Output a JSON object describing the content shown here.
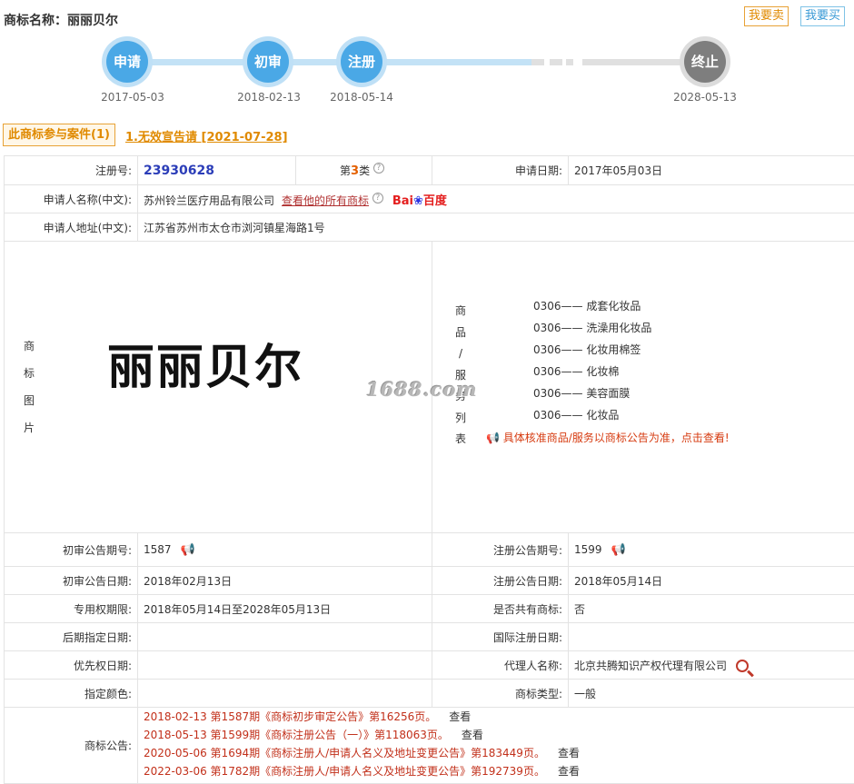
{
  "header": {
    "title": "商标名称：丽丽贝尔",
    "sell_label": "我要卖",
    "buy_label": "我要买"
  },
  "timeline": [
    {
      "label": "申请",
      "date": "2017-05-03",
      "status": "done"
    },
    {
      "label": "初审",
      "date": "2018-02-13",
      "status": "done"
    },
    {
      "label": "注册",
      "date": "2018-05-14",
      "status": "done"
    },
    {
      "label": "终止",
      "date": "2028-05-13",
      "status": "pending"
    }
  ],
  "tabs": {
    "case_label": "此商标参与案件(1)",
    "case_link": "1.无效宣告请 [2021-07-28]"
  },
  "detail": {
    "reg_no_label": "注册号:",
    "reg_no": "23930628",
    "class_prefix": "第",
    "class_num": "3",
    "class_suffix": "类",
    "apply_date_label": "申请日期:",
    "apply_date": "2017年05月03日",
    "applicant_label": "申请人名称(中文):",
    "applicant": "苏州铃兰医疗用品有限公司",
    "all_marks_link": "查看他的所有商标",
    "baidu_left": "Bai",
    "baidu_right": "百度",
    "address_label": "申请人地址(中文):",
    "address": "江苏省苏州市太仓市浏河镇星海路1号",
    "image_label": [
      "商",
      "标",
      "图",
      "片"
    ],
    "mark_text": "丽丽贝尔",
    "watermark": "1688.com",
    "goods_label": [
      "商",
      "品",
      "/",
      "服",
      "务",
      "列",
      "表"
    ],
    "goods": [
      {
        "code": "0306——",
        "name": "成套化妆品"
      },
      {
        "code": "0306——",
        "name": "洗澡用化妆品"
      },
      {
        "code": "0306——",
        "name": "化妆用棉签"
      },
      {
        "code": "0306——",
        "name": "化妆棉"
      },
      {
        "code": "0306——",
        "name": "美容面膜"
      },
      {
        "code": "0306——",
        "name": "化妆品"
      }
    ],
    "goods_note": "具体核准商品/服务以商标公告为准，点击查看!",
    "prelim_issue_label": "初审公告期号:",
    "prelim_issue": "1587",
    "reg_issue_label": "注册公告期号:",
    "reg_issue": "1599",
    "prelim_date_label": "初审公告日期:",
    "prelim_date": "2018年02月13日",
    "reg_date_label": "注册公告日期:",
    "reg_date": "2018年05月14日",
    "exclusive_label": "专用权期限:",
    "exclusive": "2018年05月14日至2028年05月13日",
    "shared_label": "是否共有商标:",
    "shared": "否",
    "later_label": "后期指定日期:",
    "later": "",
    "intl_label": "国际注册日期:",
    "intl": "",
    "priority_label": "优先权日期:",
    "priority": "",
    "agent_label": "代理人名称:",
    "agent": "北京共腾知识产权代理有限公司",
    "color_label": "指定颜色:",
    "color": "",
    "type_label": "商标类型:",
    "type": "一般",
    "ann_label": "商标公告:",
    "announcements": [
      {
        "text": "2018-02-13 第1587期《商标初步审定公告》第16256页。",
        "view": "查看"
      },
      {
        "text": "2018-05-13 第1599期《商标注册公告（一）》第118063页。",
        "view": "查看"
      },
      {
        "text": "2020-05-06 第1694期《商标注册人/申请人名义及地址变更公告》第183449页。",
        "view": "查看"
      },
      {
        "text": "2022-03-06 第1782期《商标注册人/申请人名义及地址变更公告》第192739页。",
        "view": "查看"
      }
    ]
  },
  "colors": {
    "accent_orange": "#e08a00",
    "timeline_blue": "#4aa8e6",
    "announcement_red": "#c2301a",
    "pending_gray": "#7e7e7e"
  }
}
